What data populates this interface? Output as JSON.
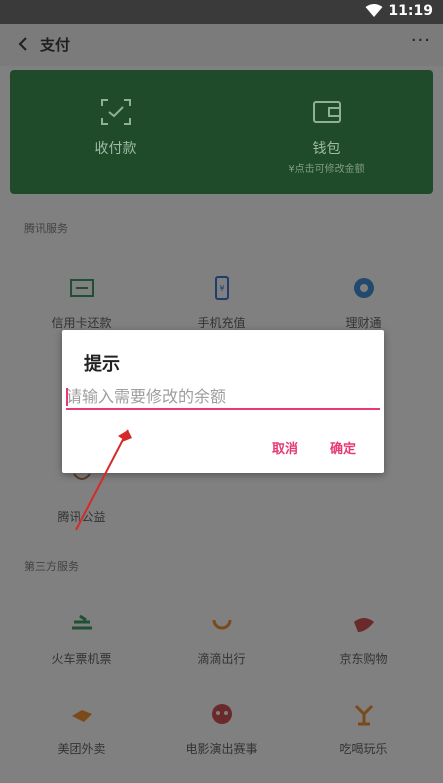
{
  "status_bar": {
    "time": "11:19"
  },
  "header": {
    "title": "支付",
    "more": "···"
  },
  "wallet_card": {
    "left": {
      "label": "收付款"
    },
    "right": {
      "label": "钱包",
      "sub": "¥点击可修改金额"
    }
  },
  "tencent_services": {
    "title": "腾讯服务",
    "items": [
      {
        "label": "信用卡还款",
        "icon": "card-icon"
      },
      {
        "label": "手机充值",
        "icon": "phone-icon"
      },
      {
        "label": "理财通",
        "icon": "finance-icon"
      },
      {
        "label": "腾讯公益",
        "icon": "charity-icon"
      }
    ]
  },
  "third_party": {
    "title": "第三方服务",
    "items": [
      {
        "label": "火车票机票",
        "icon": "train-icon"
      },
      {
        "label": "滴滴出行",
        "icon": "didi-icon"
      },
      {
        "label": "京东购物",
        "icon": "jd-icon"
      },
      {
        "label": "美团外卖",
        "icon": "meituan-icon"
      },
      {
        "label": "电影演出赛事",
        "icon": "movie-icon"
      },
      {
        "label": "吃喝玩乐",
        "icon": "fun-icon"
      }
    ]
  },
  "dialog": {
    "title": "提示",
    "input_placeholder": "请输入需要修改的余额",
    "cancel": "取消",
    "confirm": "确定"
  },
  "colors": {
    "accent": "#e53a72",
    "wallet_green": "#1f4b2a",
    "arrow_red": "#d62a2a"
  }
}
